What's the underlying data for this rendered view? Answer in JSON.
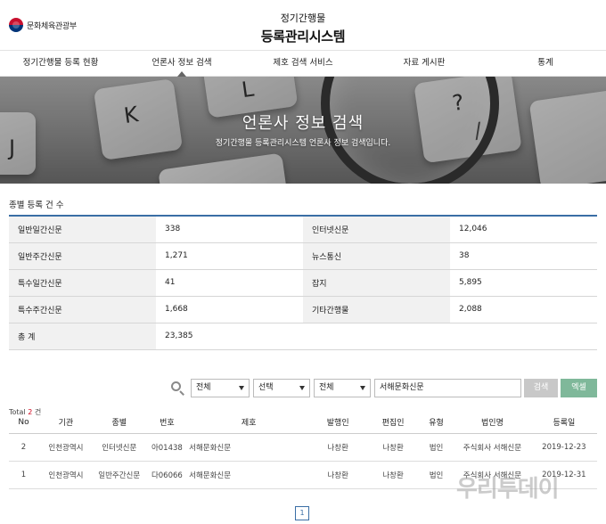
{
  "header": {
    "org_name": "문화체육관광부",
    "title_line1": "정기간행물",
    "title_line2": "등록관리시스템"
  },
  "nav": {
    "items": [
      {
        "label": "정기간행물 등록 현황"
      },
      {
        "label": "언론사 정보 검색"
      },
      {
        "label": "제호 검색 서비스"
      },
      {
        "label": "자료 게시판"
      },
      {
        "label": "통계"
      }
    ]
  },
  "banner": {
    "title": "언론사 정보 검색",
    "subtitle": "정기간행물 등록관리시스템 언론사 정보 검색입니다.",
    "keys": [
      "J",
      "K",
      "L",
      "?",
      "/"
    ]
  },
  "counts": {
    "title": "종별 등록 건 수",
    "rows": [
      [
        {
          "label": "일반일간신문",
          "value": "338"
        },
        {
          "label": "인터넷신문",
          "value": "12,046"
        }
      ],
      [
        {
          "label": "일반주간신문",
          "value": "1,271"
        },
        {
          "label": "뉴스통신",
          "value": "38"
        }
      ],
      [
        {
          "label": "특수일간신문",
          "value": "41"
        },
        {
          "label": "잡지",
          "value": "5,895"
        }
      ],
      [
        {
          "label": "특수주간신문",
          "value": "1,668"
        },
        {
          "label": "기타간행물",
          "value": "2,088"
        }
      ]
    ],
    "total_label": "총 계",
    "total_value": "23,385"
  },
  "search": {
    "select1": "전체",
    "select2": "선택",
    "select3": "전체",
    "keyword": "서해문화신문",
    "search_label": "검색",
    "excel_label": "엑셀"
  },
  "results": {
    "total_prefix": "Total",
    "total_count": "2",
    "total_suffix": "건",
    "headers": [
      "No",
      "기관",
      "종별",
      "번호",
      "제호",
      "발행인",
      "편집인",
      "유형",
      "법인명",
      "등록일"
    ],
    "rows": [
      [
        "2",
        "인천광역시",
        "인터넷신문",
        "아01438",
        "서해문화신문",
        "나창환",
        "나창환",
        "법인",
        "주식회사 서해신문",
        "2019-12-23"
      ],
      [
        "1",
        "인천광역시",
        "일반주간신문",
        "다06066",
        "서해문화신문",
        "나창환",
        "나창환",
        "법인",
        "주식회사 서해신문",
        "2019-12-31"
      ]
    ]
  },
  "pagination": {
    "current": "1"
  },
  "watermark": "우리투데이",
  "colors": {
    "accent_blue": "#3a6ea5",
    "excel_green": "#7fb89a",
    "total_red": "#d0021b"
  }
}
